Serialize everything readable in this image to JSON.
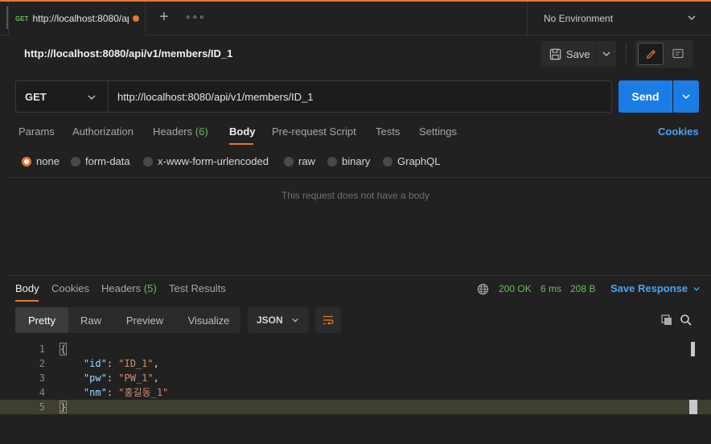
{
  "tabs": {
    "active": {
      "method": "GET",
      "url": "http://localhost:8080/api/v1/members/ID_1"
    }
  },
  "environment": {
    "label": "No Environment"
  },
  "request": {
    "title": "http://localhost:8080/api/v1/members/ID_1",
    "save_label": "Save",
    "method": "GET",
    "url": "http://localhost:8080/api/v1/members/ID_1",
    "send_label": "Send",
    "tabs": [
      {
        "label": "Params"
      },
      {
        "label": "Authorization"
      },
      {
        "label": "Headers",
        "count": "(6)"
      },
      {
        "label": "Body"
      },
      {
        "label": "Pre-request Script"
      },
      {
        "label": "Tests"
      },
      {
        "label": "Settings"
      }
    ],
    "active_tab": "Body",
    "cookies_label": "Cookies",
    "body_types": [
      "none",
      "form-data",
      "x-www-form-urlencoded",
      "raw",
      "binary",
      "GraphQL"
    ],
    "selected_body_type": "none",
    "empty_body_text": "This request does not have a body"
  },
  "response": {
    "tabs": [
      {
        "label": "Body"
      },
      {
        "label": "Cookies"
      },
      {
        "label": "Headers",
        "count": "(5)"
      },
      {
        "label": "Test Results"
      }
    ],
    "status": "200 OK",
    "time": "6 ms",
    "size": "208 B",
    "save_label": "Save Response",
    "views": [
      "Pretty",
      "Raw",
      "Preview",
      "Visualize"
    ],
    "active_view": "Pretty",
    "language": "JSON",
    "code_lines": [
      {
        "num": "1",
        "open": "{"
      },
      {
        "num": "2",
        "key": "\"id\"",
        "value": "\"ID_1\"",
        "trail": ","
      },
      {
        "num": "3",
        "key": "\"pw\"",
        "value": "\"PW_1\"",
        "trail": ","
      },
      {
        "num": "4",
        "key": "\"nm\"",
        "value": "\"홍길동_1\"",
        "trail": ""
      },
      {
        "num": "5",
        "close": "}"
      }
    ]
  },
  "colors": {
    "accent": "#e8772e",
    "primary": "#1c7ce6",
    "success": "#6bbd5b",
    "link": "#4aa3f5"
  }
}
